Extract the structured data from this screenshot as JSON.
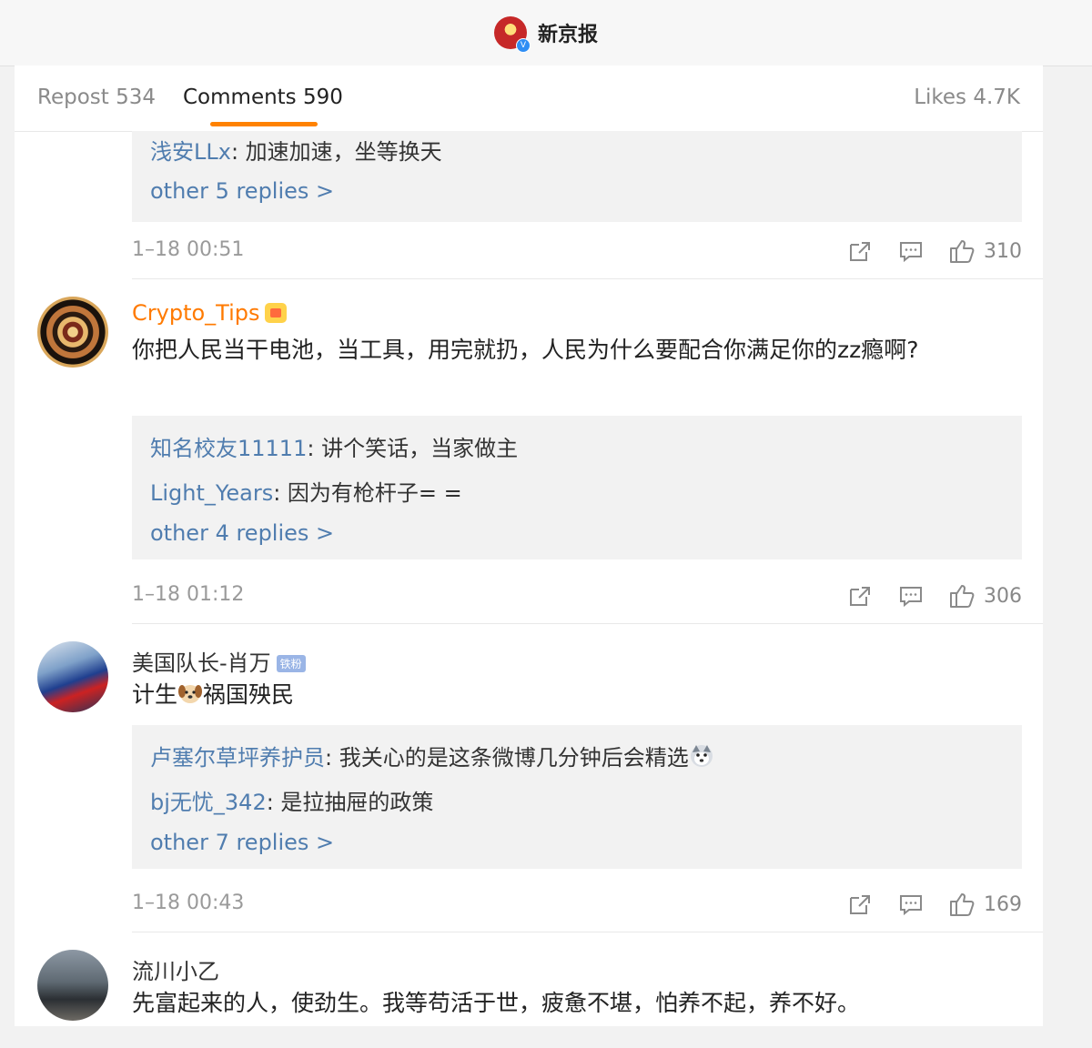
{
  "header": {
    "account_name": "新京报",
    "verified_mark": "V"
  },
  "tabs": {
    "repost": "Repost 534",
    "comments": "Comments 590",
    "likes": "Likes 4.7K"
  },
  "comments": [
    {
      "replies": [
        {
          "user": "浅安LLx",
          "text": ": 加速加速，坐等换天"
        }
      ],
      "more": "other 5 replies >",
      "time": "1–18 00:51",
      "likes": "310"
    },
    {
      "user": "Crypto_Tips",
      "text": "你把人民当干电池，当工具，用完就扔，人民为什么要配合你满足你的zz瘾啊?",
      "replies": [
        {
          "user": "知名校友11111",
          "text": ": 讲个笑话，当家做主"
        },
        {
          "user": "Light_Years",
          "text": ": 因为有枪杆子= ="
        }
      ],
      "more": "other 4 replies >",
      "time": "1–18 01:12",
      "likes": "306"
    },
    {
      "user": "美国队长-肖万",
      "badge": "铁粉",
      "text_before": "计生",
      "text_after": "祸国殃民",
      "replies": [
        {
          "user": "卢塞尔草坪养护员",
          "text": ": 我关心的是这条微博几分钟后会精选"
        },
        {
          "user": "bj无忧_342",
          "text": ": 是拉抽屉的政策"
        }
      ],
      "more": "other 7 replies >",
      "time": "1–18 00:43",
      "likes": "169"
    },
    {
      "user": "流川小乙",
      "text": "先富起来的人，使劲生。我等苟活于世，疲惫不堪，怕养不起，养不好。"
    }
  ],
  "colors": {
    "accent": "#ff8200",
    "link": "#507daf",
    "vip_name": "#ff7a00"
  },
  "icons": [
    "share-icon",
    "comment-icon",
    "thumbs-up-icon",
    "crown-badge-icon",
    "dog-emoji",
    "husky-emoji"
  ]
}
